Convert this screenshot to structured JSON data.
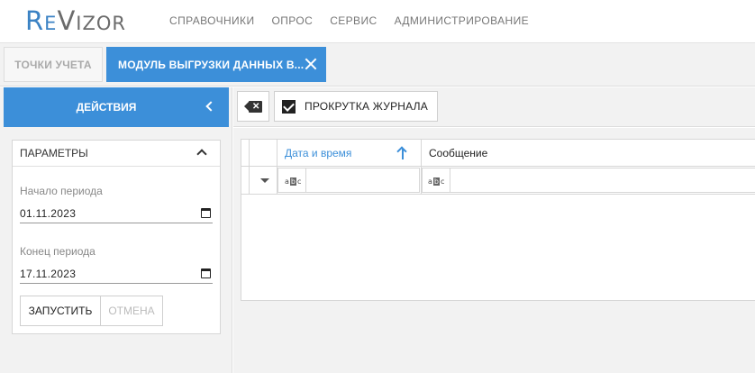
{
  "app": {
    "logo_text": "ReVizor",
    "menu": [
      "СПРАВОЧНИКИ",
      "ОПРОС",
      "СЕРВИС",
      "АДМИНИСТРИРОВАНИЕ"
    ]
  },
  "tabs": [
    {
      "label": "ТОЧКИ УЧЕТА",
      "active": false
    },
    {
      "label": "МОДУЛЬ ВЫГРУЗКИ ДАННЫХ В...",
      "active": true
    }
  ],
  "sidebar": {
    "actions_label": "ДЕЙСТВИЯ",
    "params": {
      "title": "ПАРАМЕТРЫ",
      "start_label": "Начало периода",
      "start_value": "01.11.2023",
      "end_label": "Конец периода",
      "end_value": "17.11.2023",
      "run_label": "ЗАПУСТИТЬ",
      "cancel_label": "ОТМЕНА"
    }
  },
  "toolbar": {
    "scroll_label": "ПРОКРУТКА ЖУРНАЛА",
    "scroll_checked": true
  },
  "grid": {
    "columns": [
      "Дата и время",
      "Сообщение"
    ],
    "sort_column": "Дата и время",
    "sort_direction": "ascending",
    "filter_icon": "abc-filter-icon"
  },
  "colors": {
    "accent": "#3c8fd9",
    "logo": "#3b82c4"
  }
}
